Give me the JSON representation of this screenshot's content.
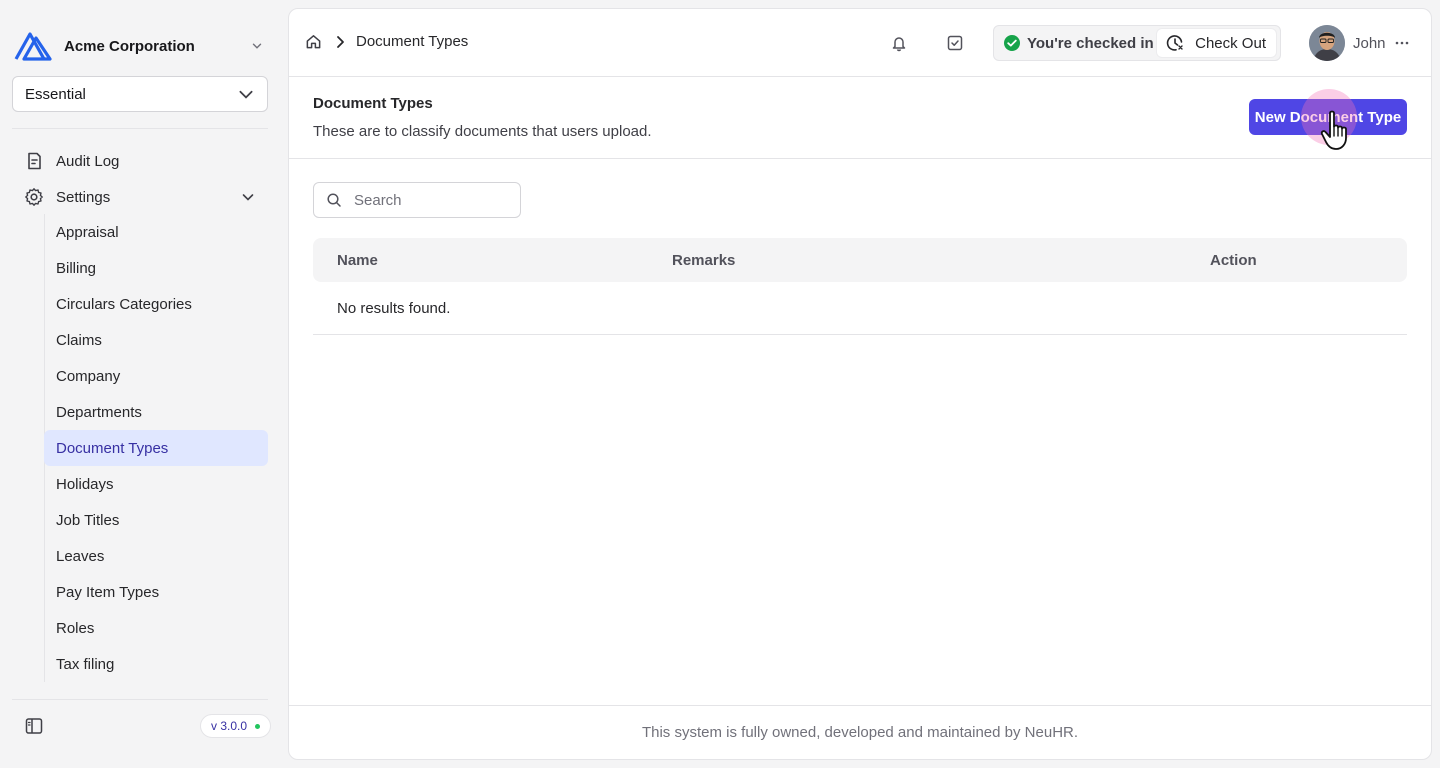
{
  "org": {
    "name": "Acme Corporation",
    "logo_color": "#2563eb"
  },
  "plan_select": {
    "value": "Essential"
  },
  "sidebar": {
    "audit_log": "Audit Log",
    "settings": "Settings",
    "settings_items": [
      "Appraisal",
      "Billing",
      "Circulars Categories",
      "Claims",
      "Company",
      "Departments",
      "Document Types",
      "Holidays",
      "Job Titles",
      "Leaves",
      "Pay Item Types",
      "Roles",
      "Tax filing"
    ],
    "active_item": "Document Types",
    "version": "v 3.0.0"
  },
  "topbar": {
    "breadcrumb": "Document Types",
    "checkin_status": "You're checked in",
    "checkout_label": "Check Out",
    "user_name": "John"
  },
  "page": {
    "title": "Document Types",
    "description": "These are to classify documents that users upload.",
    "new_button": "New Document Type"
  },
  "search": {
    "placeholder": "Search"
  },
  "table": {
    "columns": [
      "Name",
      "Remarks",
      "Action"
    ],
    "empty_message": "No results found."
  },
  "footer": "This system is fully owned, developed and maintained by NeuHR.",
  "colors": {
    "accent": "#4f46e5",
    "active_bg": "#e0e7ff",
    "status_ok": "#16a34a"
  }
}
